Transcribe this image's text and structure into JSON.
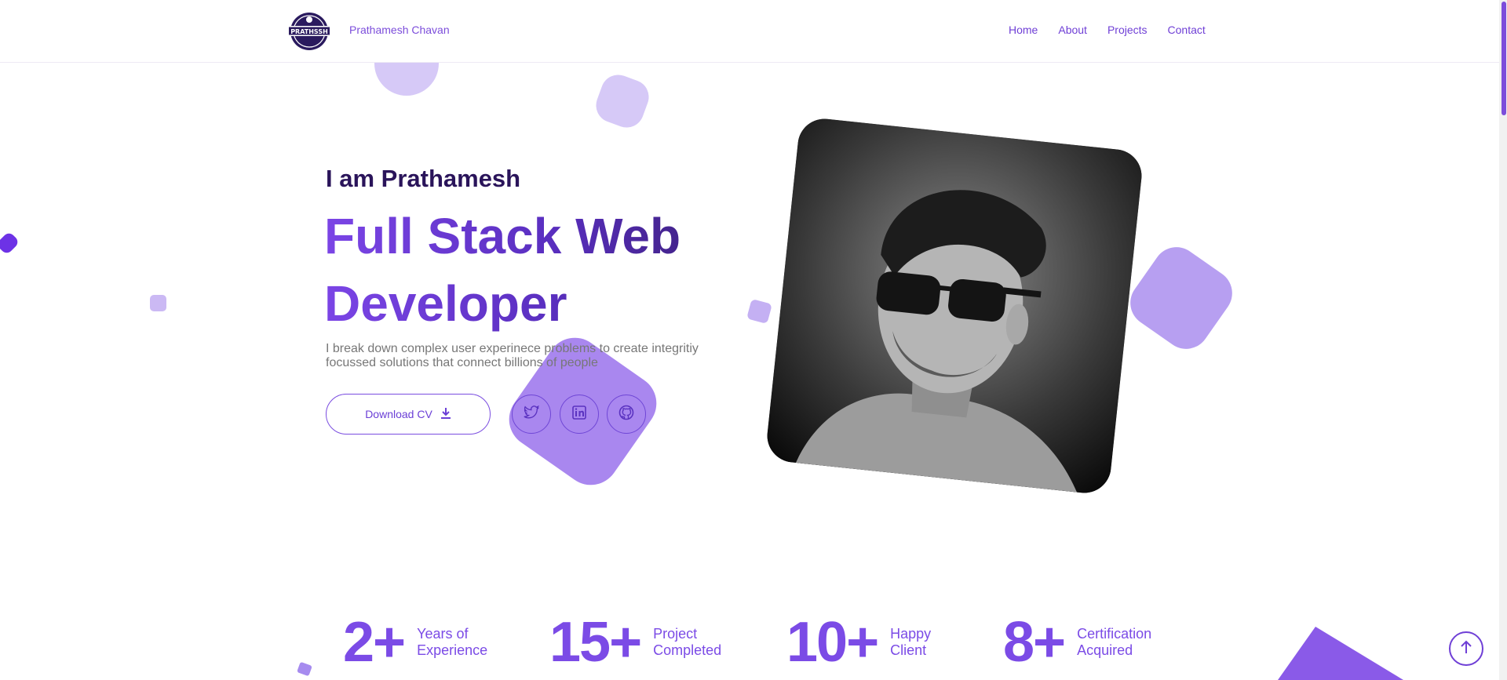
{
  "header": {
    "brand": "Prathamesh Chavan",
    "logo_text": "PRATHSSH",
    "nav": [
      {
        "label": "Home"
      },
      {
        "label": "About"
      },
      {
        "label": "Projects"
      },
      {
        "label": "Contact"
      }
    ]
  },
  "hero": {
    "intro": "I am Prathamesh",
    "title_line1": "Full Stack Web",
    "title_line2": "Developer",
    "description": "I break down complex user experinece problems to create integritiy focussed solutions that connect billions of people",
    "cv_button": "Download CV",
    "cv_icon": "download-icon",
    "socials": [
      {
        "icon": "twitter-icon"
      },
      {
        "icon": "linkedin-icon"
      },
      {
        "icon": "github-icon"
      }
    ]
  },
  "stats": [
    {
      "value": "2+",
      "label_line1": "Years of",
      "label_line2": "Experience"
    },
    {
      "value": "15+",
      "label_line1": "Project",
      "label_line2": "Completed"
    },
    {
      "value": "10+",
      "label_line1": "Happy",
      "label_line2": "Client"
    },
    {
      "value": "8+",
      "label_line1": "Certification",
      "label_line2": "Acquired"
    }
  ],
  "colors": {
    "accent": "#7b4be6",
    "dark": "#2a145a",
    "blob_light": "#d6c9f7"
  }
}
